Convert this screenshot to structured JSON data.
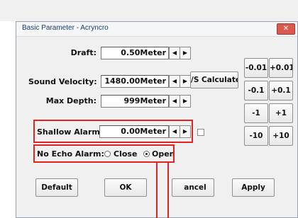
{
  "window": {
    "title": "Basic Parameter - Acryncro",
    "close_label": "✕"
  },
  "fields": {
    "draft": {
      "label": "Draft:",
      "value": "0.50Meter"
    },
    "sound_velocity": {
      "label": "Sound Velocity:",
      "value": "1480.00Meter"
    },
    "max_depth": {
      "label": "Max Depth:",
      "value": "999Meter"
    },
    "shallow_alarm": {
      "label": "Shallow Alarm:",
      "value": "0.00Meter"
    }
  },
  "spin": {
    "left": "◀",
    "right": "▶"
  },
  "calc_button": "/S Calculate",
  "no_echo_alarm": {
    "label": "No Echo Alarm:",
    "close": "Close",
    "open": "Open",
    "selected": "open"
  },
  "step_buttons": [
    "-0.01",
    "+0.01",
    "-0.1",
    "+0.1",
    "-1",
    "+1",
    "-10",
    "+10"
  ],
  "buttons": {
    "default": "Default",
    "ok": "OK",
    "cancel": "ancel",
    "apply": "Apply"
  },
  "icons": {
    "close": "close-icon",
    "spin_left": "arrow-left-icon",
    "spin_right": "arrow-right-icon"
  },
  "colors": {
    "highlight": "#e02424",
    "close_button": "#d9594c"
  }
}
